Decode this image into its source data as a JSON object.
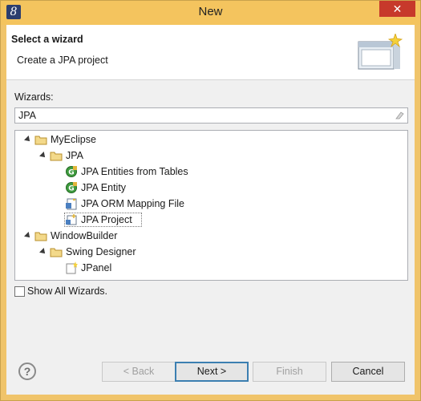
{
  "window": {
    "title": "New",
    "icon": "eclipse-app-icon",
    "close_glyph": "✕"
  },
  "header": {
    "title": "Select a wizard",
    "description": "Create a JPA project",
    "banner_icon": "new-wizard-banner-icon"
  },
  "wizards": {
    "label": "Wizards:",
    "filter_value": "JPA",
    "tree": [
      {
        "label": "MyEclipse",
        "depth": 0,
        "expanded": true,
        "icon": "folder-icon"
      },
      {
        "label": "JPA",
        "depth": 1,
        "expanded": true,
        "icon": "folder-icon"
      },
      {
        "label": "JPA Entities from Tables",
        "depth": 2,
        "icon": "jpa-entity-icon"
      },
      {
        "label": "JPA Entity",
        "depth": 2,
        "icon": "jpa-entity-icon"
      },
      {
        "label": "JPA ORM Mapping File",
        "depth": 2,
        "icon": "orm-file-icon"
      },
      {
        "label": "JPA Project",
        "depth": 2,
        "icon": "jpa-project-icon",
        "selected": true
      },
      {
        "label": "WindowBuilder",
        "depth": 0,
        "expanded": true,
        "icon": "folder-icon"
      },
      {
        "label": "Swing Designer",
        "depth": 1,
        "expanded": true,
        "icon": "folder-icon"
      },
      {
        "label": "JPanel",
        "depth": 2,
        "icon": "jpanel-icon"
      }
    ]
  },
  "show_all": {
    "label": "Show All Wizards.",
    "checked": false
  },
  "buttons": {
    "help": "?",
    "back": "< Back",
    "next": "Next >",
    "finish": "Finish",
    "cancel": "Cancel"
  },
  "colors": {
    "titlebar": "#f4c45e",
    "close": "#c7392b",
    "default_button_border": "#3c7fb1"
  }
}
